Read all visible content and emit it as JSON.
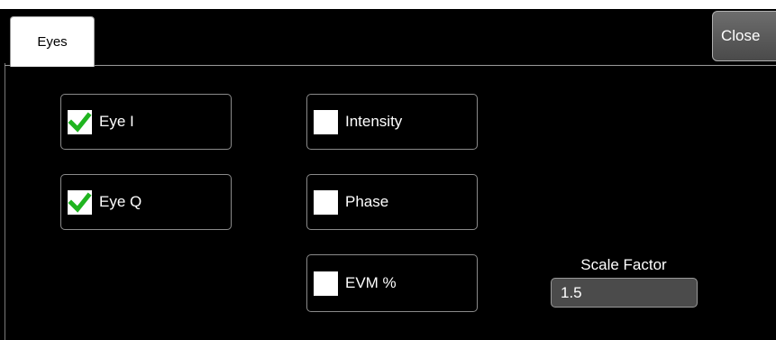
{
  "tabs": [
    {
      "label": "Eyes",
      "active": true
    }
  ],
  "close_button": {
    "label": "Close"
  },
  "checkboxes": [
    {
      "label": "Eye I",
      "checked": true
    },
    {
      "label": "Eye Q",
      "checked": true
    },
    {
      "label": "Intensity",
      "checked": false
    },
    {
      "label": "Phase",
      "checked": false
    },
    {
      "label": "EVM %",
      "checked": false
    }
  ],
  "scale_factor": {
    "label": "Scale Factor",
    "value": "1.5"
  },
  "colors": {
    "panel_background": "#000000",
    "check_mark": "#1fb41f",
    "input_background": "#4b4b4b",
    "border": "#8a8a8a"
  }
}
